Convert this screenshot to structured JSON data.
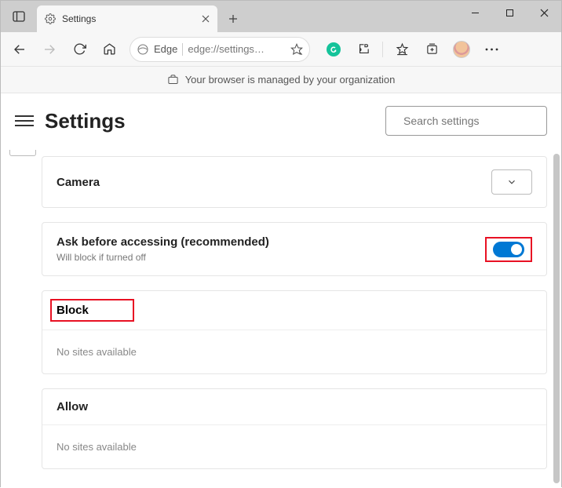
{
  "tab": {
    "title": "Settings"
  },
  "address": {
    "label": "Edge",
    "url": "edge://settings…"
  },
  "info_bar": {
    "message": "Your browser is managed by your organization"
  },
  "header": {
    "title": "Settings",
    "search_placeholder": "Search settings"
  },
  "camera_card": {
    "title": "Camera"
  },
  "ask_card": {
    "title": "Ask before accessing (recommended)",
    "subtitle": "Will block if turned off"
  },
  "block_section": {
    "title": "Block",
    "empty": "No sites available"
  },
  "allow_section": {
    "title": "Allow",
    "empty": "No sites available"
  }
}
